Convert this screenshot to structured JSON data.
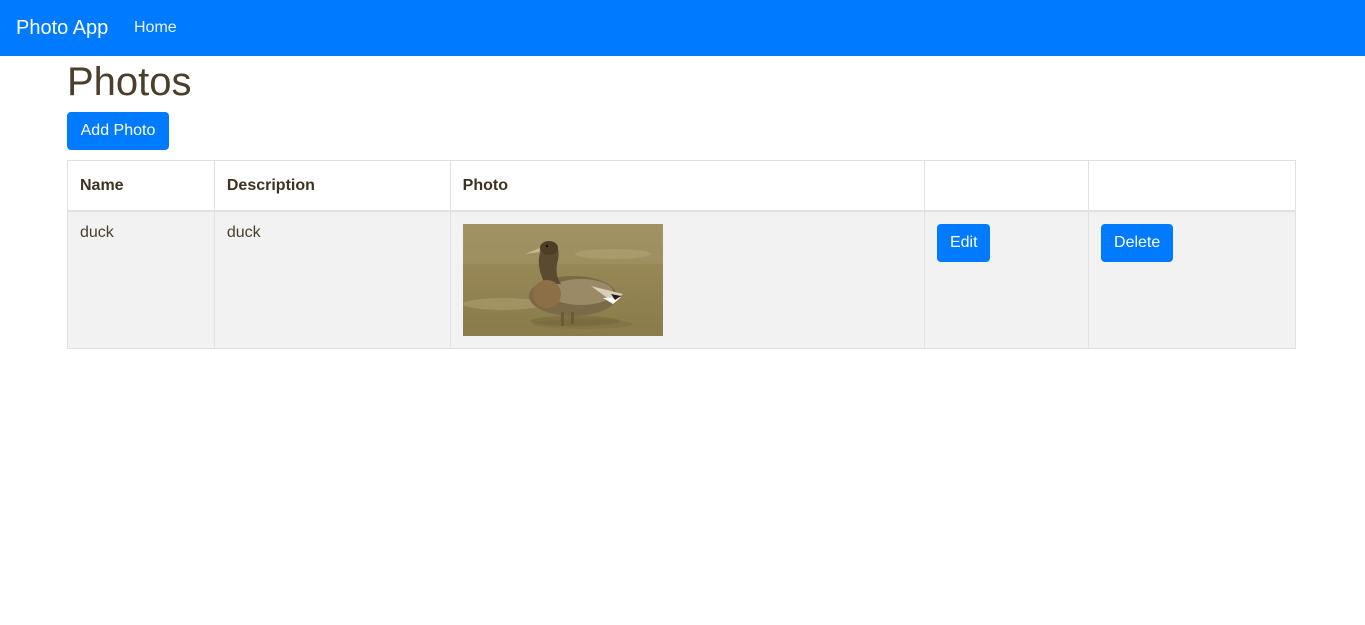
{
  "navbar": {
    "brand": "Photo App",
    "links": [
      {
        "label": "Home"
      }
    ],
    "color": "#007bff"
  },
  "page": {
    "title": "Photos",
    "add_button_label": "Add Photo"
  },
  "table": {
    "columns": [
      "Name",
      "Description",
      "Photo",
      "",
      ""
    ],
    "rows": [
      {
        "name": "duck",
        "description": "duck",
        "photo_alt": "duck",
        "edit_label": "Edit",
        "delete_label": "Delete"
      }
    ]
  }
}
